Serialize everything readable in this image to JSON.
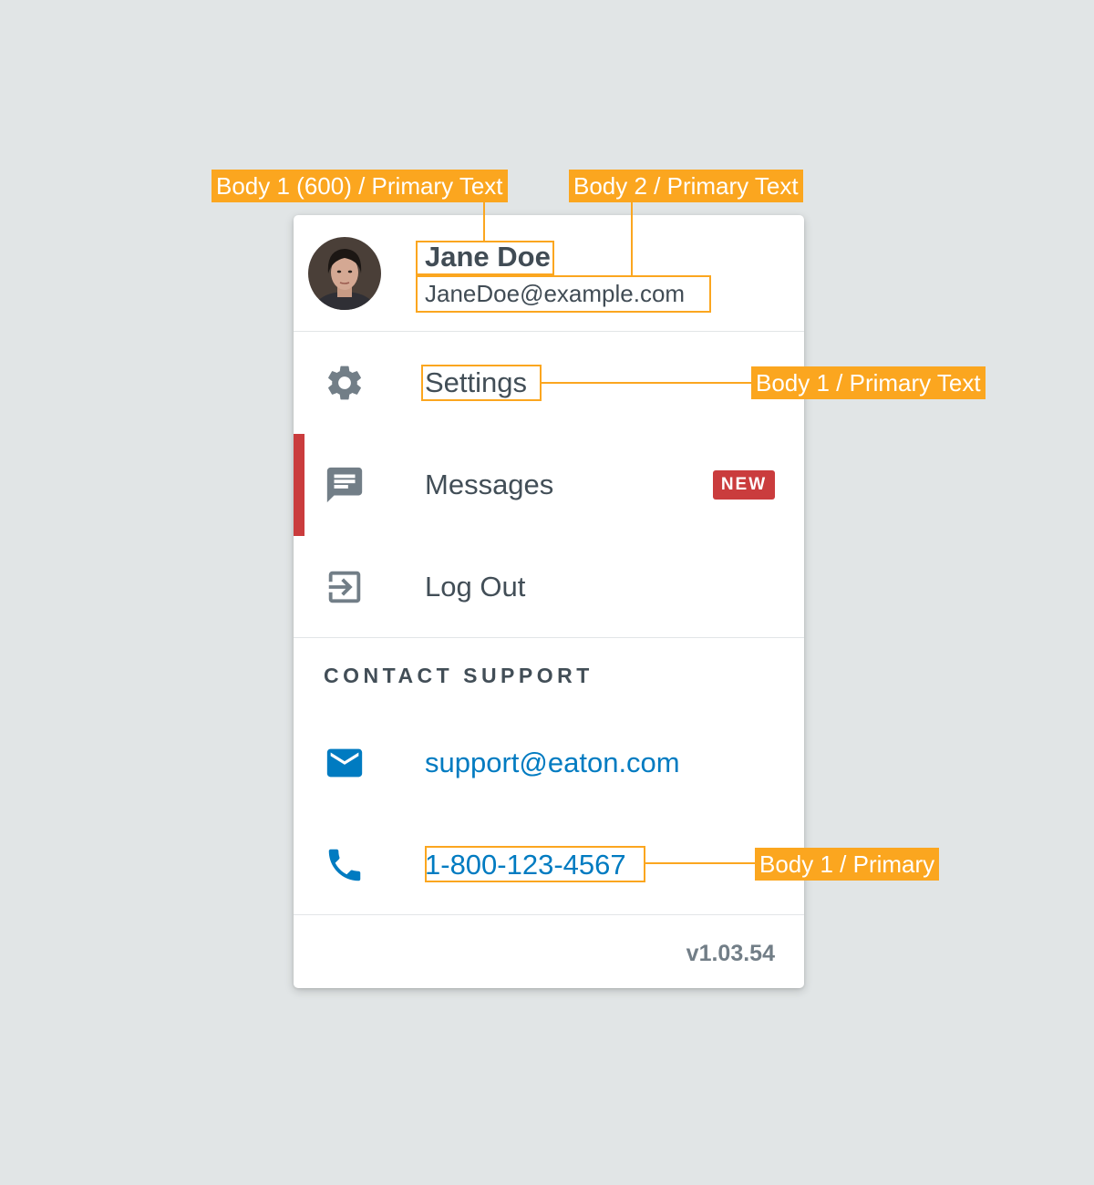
{
  "user": {
    "name": "Jane Doe",
    "email": "JaneDoe@example.com",
    "avatar_alt": "user-avatar-photo"
  },
  "nav": {
    "items": [
      {
        "label": "Settings",
        "icon": "gear-icon"
      },
      {
        "label": "Messages",
        "icon": "message-icon",
        "badge": "NEW",
        "active": true
      },
      {
        "label": "Log Out",
        "icon": "logout-icon"
      }
    ]
  },
  "support": {
    "header": "CONTACT SUPPORT",
    "email": "support@eaton.com",
    "phone": "1-800-123-4567"
  },
  "version": "v1.03.54",
  "annotations": {
    "name_style": "Body 1 (600) / Primary Text",
    "email_style": "Body 2 / Primary Text",
    "nav_style": "Body 1 / Primary Text",
    "phone_style": "Body 1 / Primary"
  },
  "colors": {
    "background": "#e1e5e6",
    "primary_text": "#424e57",
    "link": "#007bc1",
    "active_accent": "#ca3c3d",
    "icon": "#727e87",
    "annotation": "#fba61f"
  }
}
